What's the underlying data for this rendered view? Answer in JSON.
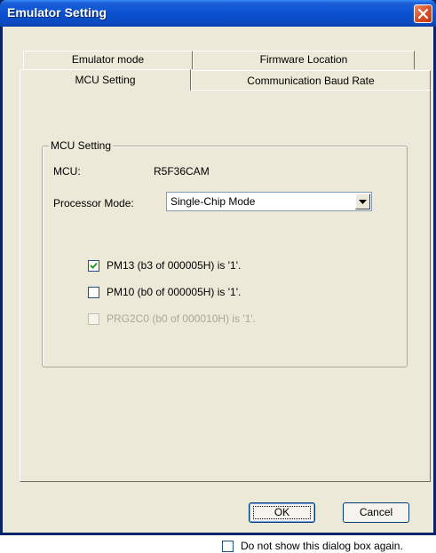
{
  "window": {
    "title": "Emulator Setting"
  },
  "tabs": {
    "row_back": [
      "Emulator mode",
      "Firmware Location"
    ],
    "row_front": [
      "MCU Setting",
      "Communication Baud Rate"
    ]
  },
  "mcu_group": {
    "title": "MCU Setting",
    "mcu_label": "MCU:",
    "mcu_value": "R5F36CAM",
    "processor_mode_label": "Processor Mode:",
    "processor_mode_value": "Single-Chip Mode",
    "options": [
      {
        "label": "PM13 (b3 of 000005H) is '1'.",
        "checked": true,
        "enabled": true
      },
      {
        "label": "PM10 (b0 of 000005H) is '1'.",
        "checked": false,
        "enabled": true
      },
      {
        "label": "PRG2C0 (b0 of 000010H) is '1'.",
        "checked": false,
        "enabled": false
      }
    ]
  },
  "buttons": {
    "ok": "OK",
    "cancel": "Cancel"
  },
  "footer": {
    "dont_show_label": "Do not show this dialog box again.",
    "dont_show_checked": false
  },
  "colors": {
    "titlebar": "#0a4fcf",
    "face": "#ece9d8",
    "disabled_text": "#aca899",
    "close": "#d9512c"
  }
}
